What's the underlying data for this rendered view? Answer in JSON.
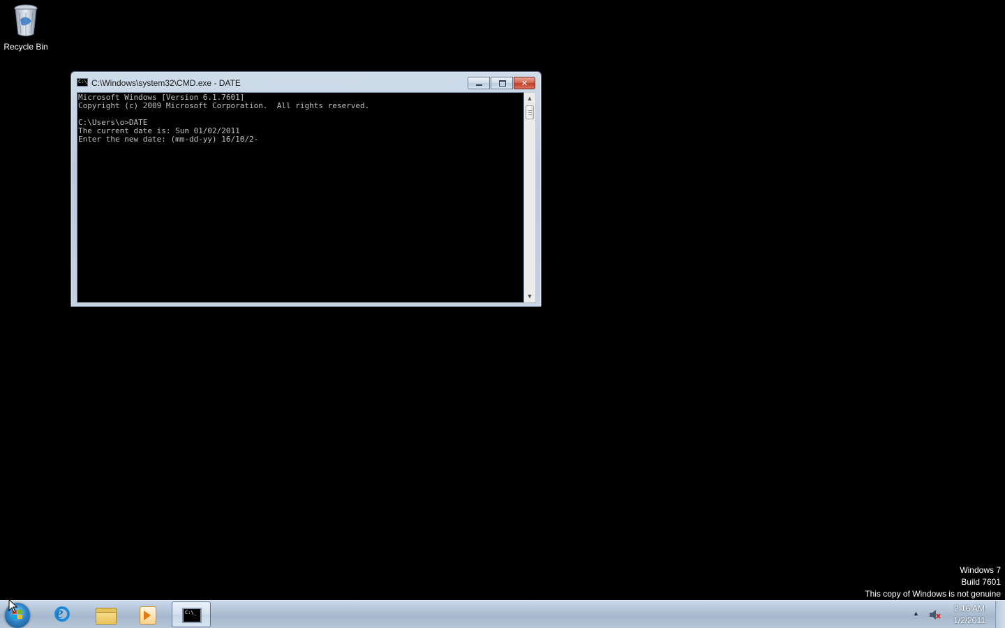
{
  "desktop": {
    "icons": [
      {
        "label": "Recycle Bin",
        "icon": "recycle-bin-icon"
      }
    ],
    "watermark": {
      "line1": "Windows 7",
      "line2": "Build 7601",
      "line3": "This copy of Windows is not genuine"
    }
  },
  "console_window": {
    "title": "C:\\Windows\\system32\\CMD.exe - DATE",
    "icon_text": "C:\\",
    "buttons": {
      "minimize": "minimize",
      "maximize": "maximize",
      "close": "close"
    },
    "text": "Microsoft Windows [Version 6.1.7601]\nCopyright (c) 2009 Microsoft Corporation.  All rights reserved.\n\nC:\\Users\\o>DATE\nThe current date is: Sun 01/02/2011\nEnter the new date: (mm-dd-yy) 16/10/2-",
    "colors": {
      "background": "#000000",
      "foreground": "#c0c0c0"
    }
  },
  "taskbar": {
    "items": [
      {
        "name": "internet-explorer",
        "icon": "internet-explorer-icon",
        "active": false
      },
      {
        "name": "windows-explorer",
        "icon": "folder-icon",
        "active": false
      },
      {
        "name": "windows-media-player",
        "icon": "media-player-icon",
        "active": false
      },
      {
        "name": "command-prompt",
        "icon": "command-prompt-icon",
        "icon_text": "C:\\_",
        "active": true
      }
    ],
    "tray": {
      "show_hidden": "▲",
      "volume_icon": "speaker-muted-icon",
      "time": "2:16 AM",
      "date": "1/2/2011"
    }
  }
}
